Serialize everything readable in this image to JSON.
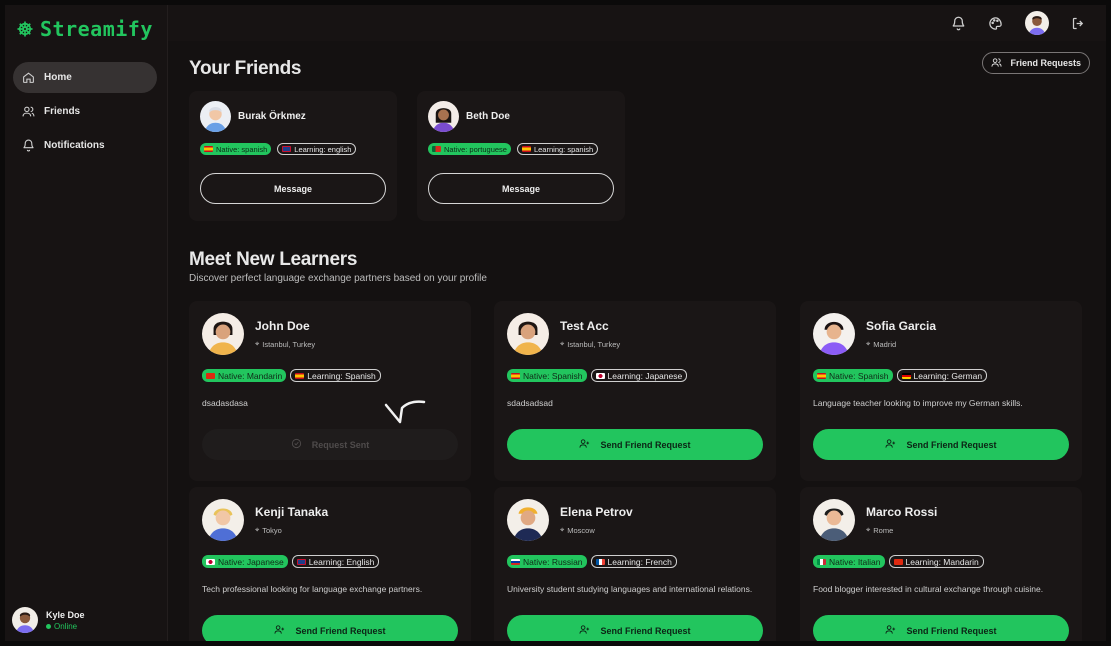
{
  "brand": {
    "name": "Streamify",
    "color": "#22c55e"
  },
  "sidebar": {
    "items": [
      {
        "label": "Home",
        "icon": "home-icon",
        "active": true
      },
      {
        "label": "Friends",
        "icon": "users-icon",
        "active": false
      },
      {
        "label": "Notifications",
        "icon": "bell-icon",
        "active": false
      }
    ],
    "user": {
      "name": "Kyle Doe",
      "status": "Online"
    }
  },
  "topbar": {
    "icons": [
      "bell-icon",
      "palette-icon",
      "avatar",
      "logout-icon"
    ]
  },
  "friends_section": {
    "title": "Your Friends",
    "requests_button": "Friend Requests",
    "friends": [
      {
        "name": "Burak Örkmez",
        "native": "Native: spanish",
        "learning": "Learning: english",
        "native_flag": "es",
        "learning_flag": "gb",
        "button": "Message"
      },
      {
        "name": "Beth Doe",
        "native": "Native: portuguese",
        "learning": "Learning: spanish",
        "native_flag": "pt",
        "learning_flag": "es",
        "button": "Message"
      }
    ]
  },
  "learners_section": {
    "title": "Meet New Learners",
    "subtitle": "Discover perfect language exchange partners based on your profile",
    "learners": [
      {
        "name": "John Doe",
        "location": "Istanbul, Turkey",
        "native": "Native: Mandarin",
        "learning": "Learning: Spanish",
        "native_flag": "cn",
        "learning_flag": "es",
        "bio": "dsadasdasa",
        "button": "Request Sent",
        "sent": true
      },
      {
        "name": "Test Acc",
        "location": "Istanbul, Turkey",
        "native": "Native: Spanish",
        "learning": "Learning: Japanese",
        "native_flag": "es",
        "learning_flag": "jp",
        "bio": "sdadsadsad",
        "button": "Send Friend Request",
        "sent": false
      },
      {
        "name": "Sofia Garcia",
        "location": "Madrid",
        "native": "Native: Spanish",
        "learning": "Learning: German",
        "native_flag": "es",
        "learning_flag": "de",
        "bio": "Language teacher looking to improve my German skills.",
        "button": "Send Friend Request",
        "sent": false
      },
      {
        "name": "Kenji Tanaka",
        "location": "Tokyo",
        "native": "Native: Japanese",
        "learning": "Learning: English",
        "native_flag": "jp",
        "learning_flag": "gb",
        "bio": "Tech professional looking for language exchange partners.",
        "button": "Send Friend Request",
        "sent": false
      },
      {
        "name": "Elena Petrov",
        "location": "Moscow",
        "native": "Native: Russian",
        "learning": "Learning: French",
        "native_flag": "ru",
        "learning_flag": "fr",
        "bio": "University student studying languages and international relations.",
        "button": "Send Friend Request",
        "sent": false
      },
      {
        "name": "Marco Rossi",
        "location": "Rome",
        "native": "Native: Italian",
        "learning": "Learning: Mandarin",
        "native_flag": "it",
        "learning_flag": "cn",
        "bio": "Food blogger interested in cultural exchange through cuisine.",
        "button": "Send Friend Request",
        "sent": false
      }
    ]
  }
}
